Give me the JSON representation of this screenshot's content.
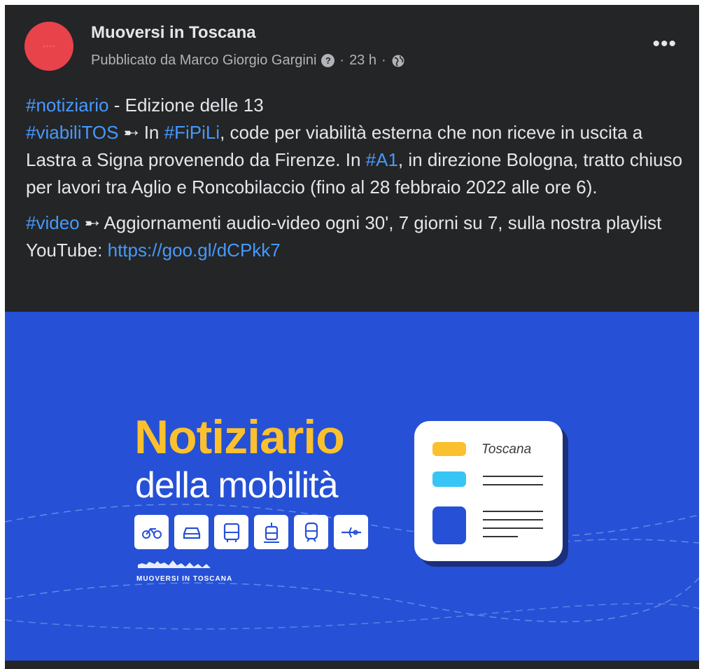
{
  "post": {
    "page_name": "Muoversi in Toscana",
    "published_by": "Pubblicato da Marco Giorgio Gargini",
    "time_ago": "23 h",
    "separator": "·",
    "more_label": "•••"
  },
  "text": {
    "line1_tag": "#notiziario",
    "line1_rest": " - Edizione delle 13",
    "p1_tag1": "#viabiliTOS",
    "p1_text1": " ➸ In ",
    "p1_tag2": "#FiPiLi",
    "p1_text2": ", code per viabilità esterna che non riceve in uscita a Lastra a Signa provenendo da Firenze. In ",
    "p1_tag3": "#A1",
    "p1_text3": ", in direzione Bologna, tratto chiuso per lavori tra Aglio e Roncobilaccio (fino al 28 febbraio 2022 alle ore 6).",
    "p2_tag": "#video",
    "p2_text": " ➸ Aggiornamenti audio-video ogni 30', 7 giorni su 7, sulla nostra playlist YouTube: ",
    "p2_link": "https://goo.gl/dCPkk7"
  },
  "banner": {
    "title": "Notiziario",
    "subtitle": "della mobilità",
    "card_label": "Toscana",
    "logo_text": "MUOVERSI IN TOSCANA",
    "modes": [
      "bicycle-icon",
      "car-icon",
      "bus-icon",
      "tram-icon",
      "train-icon",
      "plane-icon"
    ],
    "colors": {
      "background": "#2651d6",
      "title": "#fbc02d",
      "link": "#4599ff"
    }
  }
}
